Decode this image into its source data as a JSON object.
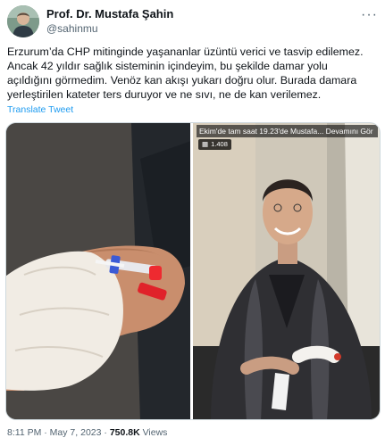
{
  "tweet": {
    "display_name": "Prof. Dr. Mustafa Şahin",
    "handle": "@sahinmu",
    "more_label": "···",
    "text": "Erzurum’da CHP mitinginde yaşananlar üzüntü verici ve tasvip edilemez.\nAncak 42 yıldır sağlık sisteminin içindeyim, bu şekilde damar yolu\naçıldığını görmedim. Venöz kan akışı yukarı doğru olur. Burada damara\nyerleştirilen kateter ters duruyor ve ne sıvı, ne de kan verilemez.",
    "translate_label": "Translate Tweet",
    "time": "8:11 PM",
    "separator1": " · ",
    "date": "May 7, 2023",
    "separator2": " · ",
    "views_count": "750.8K",
    "views_label": " Views"
  },
  "media": {
    "video_banner": "Ekim'de tam saat 19.23'de Mustafa... Devamını Gör",
    "view_badge": "1.408"
  },
  "colors": {
    "link": "#1d9bf0",
    "secondary": "#536471",
    "primary_text": "#0f1419",
    "border": "#cfd9de"
  }
}
